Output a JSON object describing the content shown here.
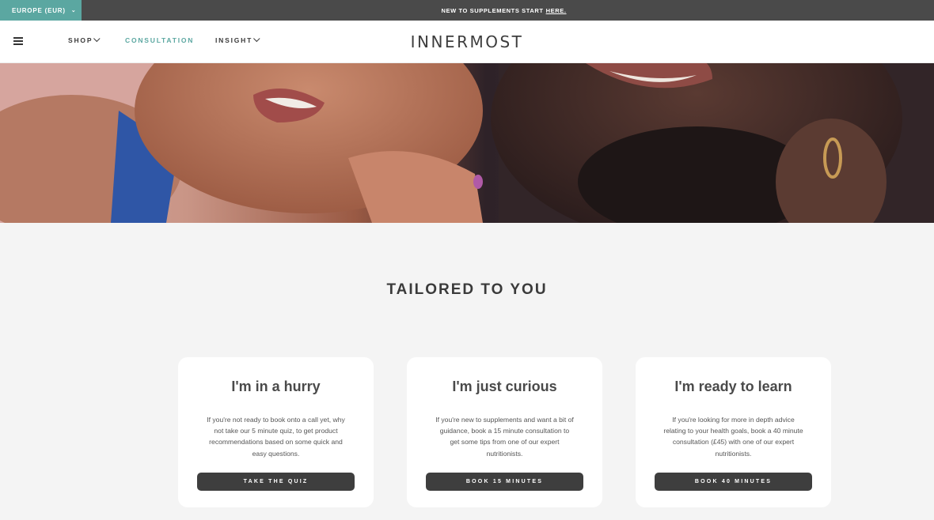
{
  "topbar": {
    "region_label": "EUROPE (EUR)",
    "announcement_text": "NEW TO SUPPLEMENTS START",
    "announcement_link": "HERE."
  },
  "header": {
    "nav": {
      "shop": "SHOP",
      "consultation": "CONSULTATION",
      "insight": "INSIGHT"
    },
    "logo": "INNERMOST"
  },
  "colors": {
    "accent": "#5ba7a1",
    "topbar_bg": "#4a4a4a",
    "button_bg": "#3e3e3e"
  },
  "section": {
    "title": "TAILORED TO YOU"
  },
  "cards": [
    {
      "title": "I'm in a hurry",
      "body": "If you're not ready to book onto a call yet, why not take our 5 minute quiz, to get product recommendations based on some quick and easy questions.",
      "button": "TAKE THE QUIZ"
    },
    {
      "title": "I'm just curious",
      "body": "If you're new to supplements and want a bit of guidance, book a 15 minute consultation to get some tips from one of our expert nutritionists.",
      "button": "BOOK 15 MINUTES"
    },
    {
      "title": "I'm ready to learn",
      "body": "If you're looking for more in depth advice relating to your health goals, book a 40 minute consultation (£45) with one of our expert nutritionists.",
      "button": "BOOK 40 MINUTES"
    }
  ]
}
